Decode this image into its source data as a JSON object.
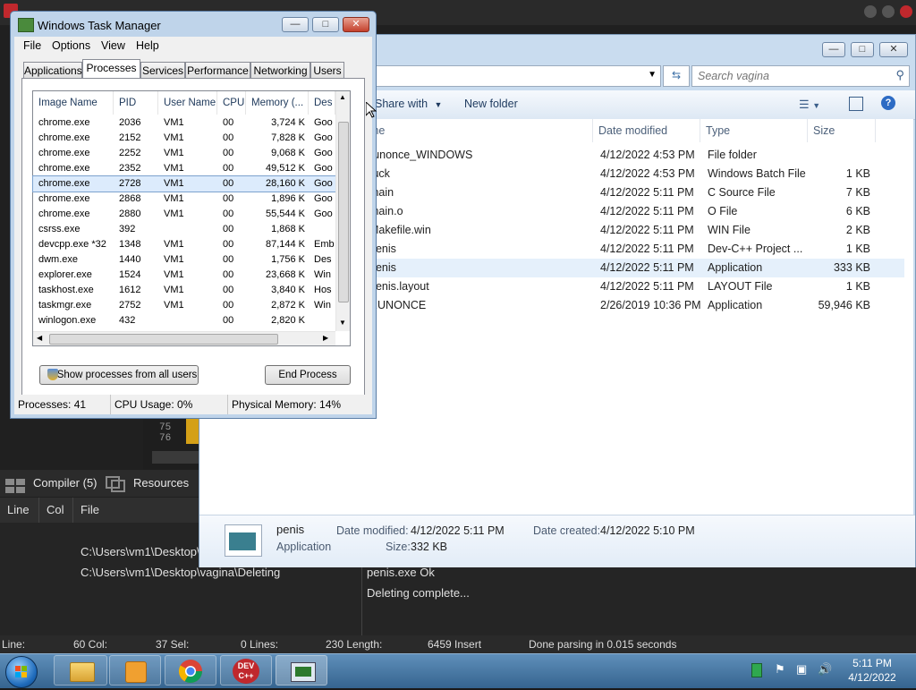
{
  "devcpp": {
    "editor_lines": [
      "74",
      "75",
      "76"
    ],
    "tabs": {
      "compiler": "Compiler (5)",
      "resources": "Resources"
    },
    "log_columns": {
      "line": "Line",
      "col": "Col",
      "file": "File"
    },
    "log_rows": [
      {
        "file": "C:\\Users\\vm1\\Desktop\\",
        "message": ""
      },
      {
        "file": "C:\\Users\\vm1\\Desktop\\vagina\\Deleting",
        "message": "penis.exe Ok"
      },
      {
        "file": "",
        "message": "Deleting complete..."
      }
    ],
    "status": {
      "line": "Line:",
      "col": "60 Col:",
      "sel": "37 Sel:",
      "lines": "0 Lines:",
      "length": "230 Length:",
      "insert": "6459 Insert",
      "parsing": "Done parsing in 0.015 seconds"
    }
  },
  "explorer": {
    "search_placeholder": "Search vagina",
    "toolbar": {
      "share_with": "Share with",
      "new_folder": "New folder"
    },
    "columns": {
      "name": "Name",
      "date": "Date modified",
      "type": "Type",
      "size": "Size"
    },
    "files": [
      {
        "name": "runonce_WINDOWS",
        "date": "4/12/2022 4:53 PM",
        "type": "File folder",
        "size": ""
      },
      {
        "name": "fuck",
        "date": "4/12/2022 4:53 PM",
        "type": "Windows Batch File",
        "size": "1 KB"
      },
      {
        "name": "main",
        "date": "4/12/2022 5:11 PM",
        "type": "C Source File",
        "size": "7 KB"
      },
      {
        "name": "main.o",
        "date": "4/12/2022 5:11 PM",
        "type": "O File",
        "size": "6 KB"
      },
      {
        "name": "Makefile.win",
        "date": "4/12/2022 5:11 PM",
        "type": "WIN File",
        "size": "2 KB"
      },
      {
        "name": "penis",
        "date": "4/12/2022 5:11 PM",
        "type": "Dev-C++ Project ...",
        "size": "1 KB"
      },
      {
        "name": "penis",
        "date": "4/12/2022 5:11 PM",
        "type": "Application",
        "size": "333 KB"
      },
      {
        "name": "penis.layout",
        "date": "4/12/2022 5:11 PM",
        "type": "LAYOUT File",
        "size": "1 KB"
      },
      {
        "name": "RUNONCE",
        "date": "2/26/2019 10:36 PM",
        "type": "Application",
        "size": "59,946 KB"
      }
    ],
    "selected_index": 6,
    "details": {
      "name": "penis",
      "kind": "Application",
      "date_modified_label": "Date modified:",
      "date_modified": "4/12/2022 5:11 PM",
      "size_label": "Size:",
      "size": "332 KB",
      "date_created_label": "Date created:",
      "date_created": "4/12/2022 5:10 PM"
    }
  },
  "taskmgr": {
    "title": "Windows Task Manager",
    "menu": [
      "File",
      "Options",
      "View",
      "Help"
    ],
    "tabs": [
      "Applications",
      "Processes",
      "Services",
      "Performance",
      "Networking",
      "Users"
    ],
    "active_tab": "Processes",
    "columns": [
      "Image Name",
      "PID",
      "User Name",
      "CPU",
      "Memory (...",
      "Des"
    ],
    "processes": [
      {
        "name": "chrome.exe",
        "pid": "2036",
        "user": "VM1",
        "cpu": "00",
        "mem": "3,724 K",
        "desc": "Goo"
      },
      {
        "name": "chrome.exe",
        "pid": "2152",
        "user": "VM1",
        "cpu": "00",
        "mem": "7,828 K",
        "desc": "Goo"
      },
      {
        "name": "chrome.exe",
        "pid": "2252",
        "user": "VM1",
        "cpu": "00",
        "mem": "9,068 K",
        "desc": "Goo"
      },
      {
        "name": "chrome.exe",
        "pid": "2352",
        "user": "VM1",
        "cpu": "00",
        "mem": "49,512 K",
        "desc": "Goo"
      },
      {
        "name": "chrome.exe",
        "pid": "2728",
        "user": "VM1",
        "cpu": "00",
        "mem": "28,160 K",
        "desc": "Goo"
      },
      {
        "name": "chrome.exe",
        "pid": "2868",
        "user": "VM1",
        "cpu": "00",
        "mem": "1,896 K",
        "desc": "Goo"
      },
      {
        "name": "chrome.exe",
        "pid": "2880",
        "user": "VM1",
        "cpu": "00",
        "mem": "55,544 K",
        "desc": "Goo"
      },
      {
        "name": "csrss.exe",
        "pid": "392",
        "user": "",
        "cpu": "00",
        "mem": "1,868 K",
        "desc": ""
      },
      {
        "name": "devcpp.exe *32",
        "pid": "1348",
        "user": "VM1",
        "cpu": "00",
        "mem": "87,144 K",
        "desc": "Emb"
      },
      {
        "name": "dwm.exe",
        "pid": "1440",
        "user": "VM1",
        "cpu": "00",
        "mem": "1,756 K",
        "desc": "Des"
      },
      {
        "name": "explorer.exe",
        "pid": "1524",
        "user": "VM1",
        "cpu": "00",
        "mem": "23,668 K",
        "desc": "Win"
      },
      {
        "name": "taskhost.exe",
        "pid": "1612",
        "user": "VM1",
        "cpu": "00",
        "mem": "3,840 K",
        "desc": "Hos"
      },
      {
        "name": "taskmgr.exe",
        "pid": "2752",
        "user": "VM1",
        "cpu": "00",
        "mem": "2,872 K",
        "desc": "Win"
      },
      {
        "name": "winlogon.exe",
        "pid": "432",
        "user": "",
        "cpu": "00",
        "mem": "2,820 K",
        "desc": ""
      }
    ],
    "selected_index": 4,
    "buttons": {
      "show_all": "Show processes from all users",
      "end_process": "End Process"
    },
    "status": {
      "processes": "Processes: 41",
      "cpu": "CPU Usage: 0%",
      "memory": "Physical Memory: 14%"
    }
  },
  "taskbar": {
    "clock_time": "5:11 PM",
    "clock_date": "4/12/2022",
    "devcpp_label": "DEV C++"
  }
}
